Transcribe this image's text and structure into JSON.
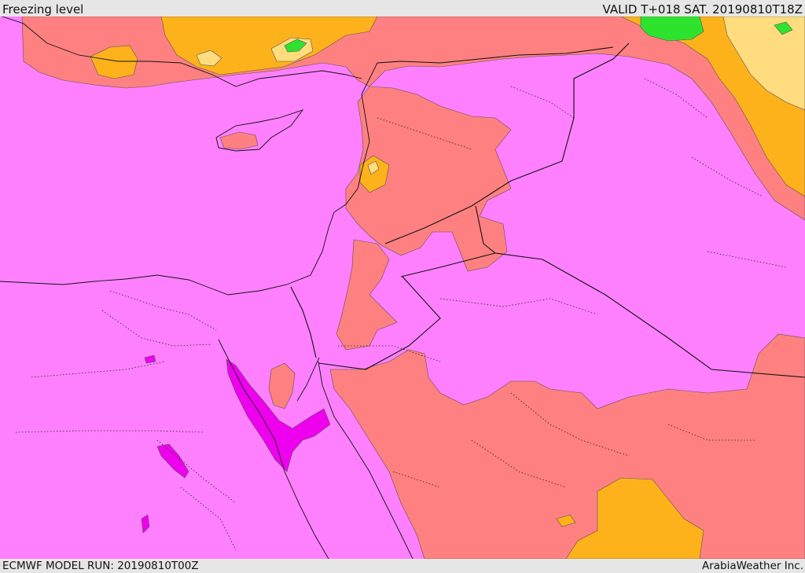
{
  "header": {
    "title": "Freezing level",
    "valid": "VALID T+018 SAT. 20190810T18Z"
  },
  "footer": {
    "model_run": "ECMWF MODEL RUN: 20190810T00Z",
    "credit": "ArabiaWeather Inc."
  },
  "colors": {
    "base": "#ff80ff",
    "low": "#ee00ee",
    "salmon": "#ff8080",
    "orange": "#fdb21b",
    "yellow": "#ffdc7e",
    "green": "#2ee32e",
    "bar_bg": "#e6e6e6"
  }
}
